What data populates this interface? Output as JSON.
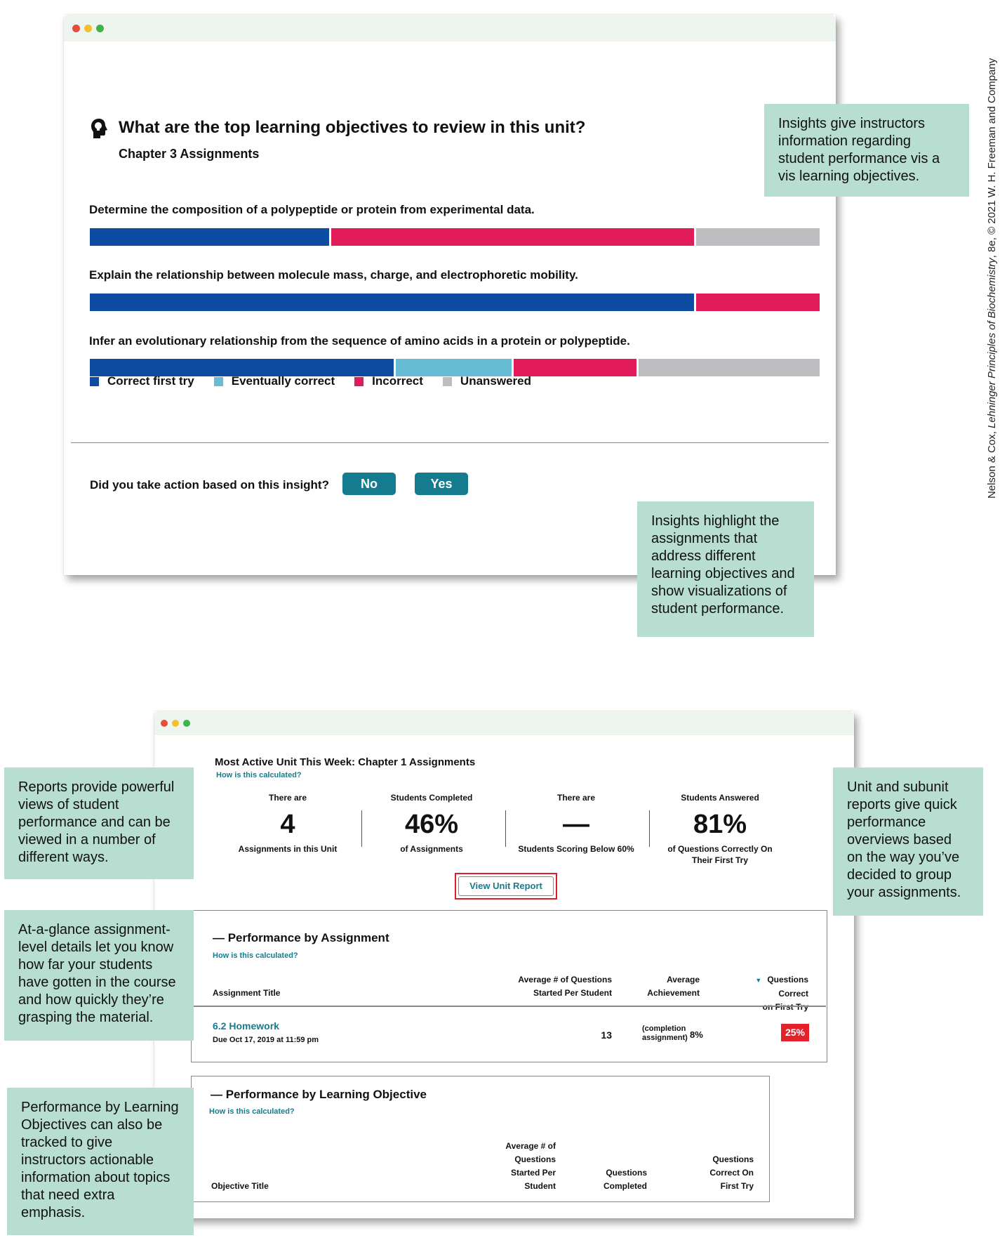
{
  "insight_window": {
    "question": "What are the top learning objectives to review in this unit?",
    "subtitle": "Chapter 3 Assignments",
    "objectives": [
      {
        "label": "Determine the composition of a polypeptide or protein from experimental data.",
        "correct_first_try": 33,
        "eventually_correct": 0,
        "incorrect": 50,
        "unanswered": 17
      },
      {
        "label": "Explain the relationship between molecule mass, charge, and electrophoretic mobility.",
        "correct_first_try": 83,
        "eventually_correct": 0,
        "incorrect": 17,
        "unanswered": 0
      },
      {
        "label": "Infer an evolutionary relationship from the sequence of amino acids in a protein or polypeptide.",
        "correct_first_try": 42,
        "eventually_correct": 16,
        "incorrect": 17,
        "unanswered": 25
      }
    ],
    "legend": {
      "correct_first_try": "Correct first try",
      "eventually_correct": "Eventually correct",
      "incorrect": "Incorrect",
      "unanswered": "Unanswered"
    },
    "colors": {
      "correct_first_try": "#0e4ca1",
      "eventually_correct": "#67bcd6",
      "incorrect": "#e21b5a",
      "unanswered": "#bdbdbf"
    },
    "action_prompt": "Did you take action based on this insight?",
    "no_label": "No",
    "yes_label": "Yes",
    "icon": "lightbulb-head-icon"
  },
  "report_window": {
    "title": "Most Active Unit This Week: Chapter 1 Assignments",
    "how_calculated": "How is this calculated?",
    "stats": [
      {
        "top": "There are",
        "value": "4",
        "caption": "Assignments in this Unit"
      },
      {
        "top": "Students Completed",
        "value": "46%",
        "caption": "of Assignments"
      },
      {
        "top": "There are",
        "value": "—",
        "caption": "Students Scoring Below 60%"
      },
      {
        "top": "Students Answered",
        "value": "81%",
        "caption": "of Questions Correctly On Their First Try"
      }
    ],
    "view_report": "View Unit Report",
    "perf_assignment": {
      "heading": "— Performance by Assignment",
      "how": "How is this calculated?",
      "col_title": "Assignment Title",
      "col_avg_q_1": "Average # of Questions",
      "col_avg_q_2": "Started Per Student",
      "col_ach_1": "Average",
      "col_ach_2": "Achievement",
      "col_qc_1": "Questions Correct",
      "col_qc_2": "on First Try",
      "row": {
        "title": "6.2 Homework",
        "due": "Due Oct 17, 2019 at 11:59 pm",
        "avg_started": "13",
        "ach_note_1": "(completion",
        "ach_note_2": "assignment)",
        "ach_value": "8%",
        "first_try": "25%"
      }
    },
    "perf_objective": {
      "heading": "— Performance by Learning Objective",
      "how": "How is this calculated?",
      "col_title": "Objective Title",
      "col_avg": [
        "Average # of",
        "Questions",
        "Started Per",
        "Student"
      ],
      "col_completed": [
        "Questions",
        "Completed"
      ],
      "col_first": [
        "Questions",
        "Correct On",
        "First Try"
      ]
    }
  },
  "callouts": {
    "insight_objectives": "Insights give instructors information regarding student performance vis a vis learning objectives.",
    "insight_assignments": "Insights highlight the assignments that address different learning objectives and show visualizations of student performance.",
    "reports": "Reports provide powerful views of student performance and can be viewed in a number of different ways.",
    "unit_reports": "Unit and subunit reports give quick performance overviews based on the way you’ve decided to group your assignments.",
    "at_a_glance": "At-a-glance assignment-level details let you know how far your students have gotten in the course and how quickly they’re grasping the material.",
    "perf_objectives": "Performance by Learning Objectives can also be tracked to give instructors actionable information about topics that need extra emphasis."
  },
  "credit": {
    "authors": "Nelson & Cox, ",
    "book": "Lehninger Principles of Biochemistry",
    "rest": ", 8e, © 2021 W. H. Freeman and Company"
  }
}
